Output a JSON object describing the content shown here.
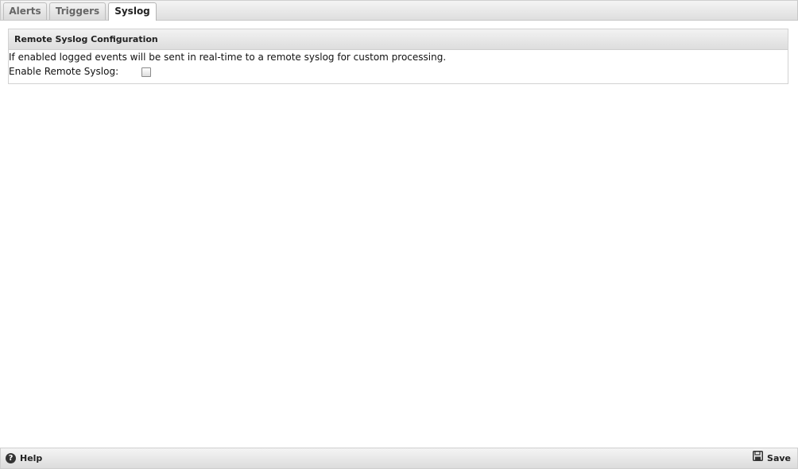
{
  "tabs": [
    {
      "label": "Alerts",
      "active": false
    },
    {
      "label": "Triggers",
      "active": false
    },
    {
      "label": "Syslog",
      "active": true
    }
  ],
  "panel": {
    "title": "Remote Syslog Configuration",
    "description": "If enabled logged events will be sent in real-time to a remote syslog for custom processing.",
    "enable_label": "Enable Remote Syslog:",
    "enable_checked": false
  },
  "footer": {
    "help_label": "Help",
    "help_icon": "question-circle-icon",
    "help_icon_glyph": "?",
    "save_label": "Save",
    "save_icon": "floppy-disk-icon"
  }
}
